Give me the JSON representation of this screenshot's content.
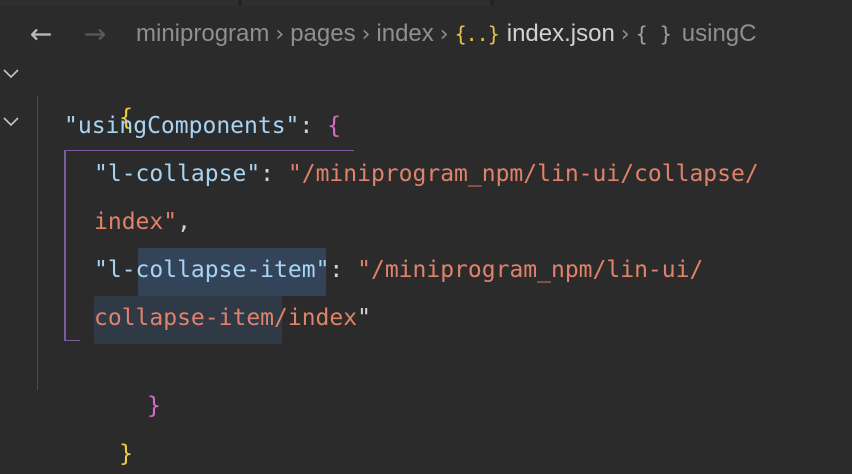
{
  "breadcrumb": {
    "back_icon": "arrow-left-icon",
    "forward_icon": "arrow-right-icon",
    "items": [
      "miniprogram",
      "pages",
      "index",
      "index.json",
      "usingC"
    ],
    "json_file_icon": "{..}",
    "json_object_icon": "{ }"
  },
  "editor": {
    "language": "json",
    "open_brace": "{",
    "close_brace": "}",
    "key_usingComponents": "\"usingComponents\"",
    "colon": ": ",
    "inner_open": "{",
    "inner_close": "}",
    "entry1_key": "\"l-collapse\"",
    "entry1_value_part1": "\"/miniprogram_npm/lin-ui/collapse/",
    "entry1_value_part2": "index\"",
    "comma": ",",
    "entry2_key_quote_open": "\"l-",
    "entry2_key_selected": "collapse-item",
    "entry2_key_quote_close": "\"",
    "entry2_value_part1": "\"/miniprogram_npm/lin-ui/",
    "entry2_value_part2": "collapse-item/index",
    "entry2_value_close": "\""
  },
  "colors": {
    "background": "#2b2b2b",
    "key": "#a8d4f4",
    "string": "#e0826a",
    "outer_brace": "#f2cc3c",
    "inner_brace": "#d36ec7",
    "selection": "#334459"
  }
}
